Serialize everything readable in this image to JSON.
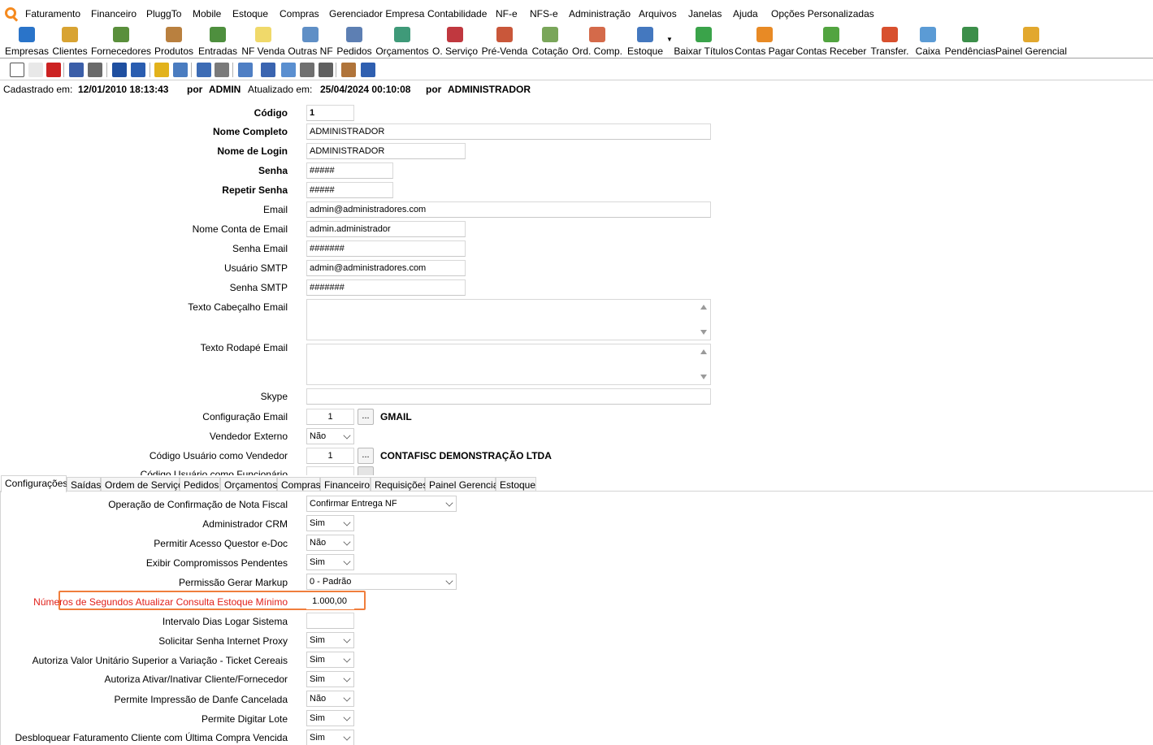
{
  "menu": {
    "logo_name": "app-logo-icon",
    "items": [
      "Faturamento",
      "Financeiro",
      "PluggTo",
      "Mobile",
      "Estoque",
      "Compras",
      "Gerenciador Empresa",
      "Contabilidade",
      "NF-e",
      "NFS-e",
      "Administração",
      "Arquivos",
      "Janelas",
      "Ajuda",
      "Opções Personalizadas"
    ]
  },
  "big_toolbar": [
    {
      "label": "Empresas",
      "icon": "empresas-icon",
      "color": "#2a74c9"
    },
    {
      "label": "Clientes",
      "icon": "clientes-icon",
      "color": "#d8a332"
    },
    {
      "label": "Fornecedores",
      "icon": "fornecedores-icon",
      "color": "#5a8f3c"
    },
    {
      "label": "Produtos",
      "icon": "produtos-icon",
      "color": "#b9803f"
    },
    {
      "label": "Entradas",
      "icon": "entradas-icon",
      "color": "#4e8f3e"
    },
    {
      "label": "NF Venda",
      "icon": "nf-venda-icon",
      "color": "#f0d96a"
    },
    {
      "label": "Outras NF",
      "icon": "outras-nf-icon",
      "color": "#5f8fc6"
    },
    {
      "label": "Pedidos",
      "icon": "pedidos-icon",
      "color": "#5d7fb3"
    },
    {
      "label": "Orçamentos",
      "icon": "orcamentos-icon",
      "color": "#3f9a79"
    },
    {
      "label": "O. Serviço",
      "icon": "ordem-servico-icon",
      "color": "#c0383f"
    },
    {
      "label": "Pré-Venda",
      "icon": "pre-venda-icon",
      "color": "#c9573a"
    },
    {
      "label": "Cotação",
      "icon": "cotacao-icon",
      "color": "#7aa65a"
    },
    {
      "label": "Ord. Comp.",
      "icon": "ordem-compra-icon",
      "color": "#d46a4a"
    },
    {
      "label": "Estoque",
      "icon": "estoque-icon",
      "color": "#4478bf"
    },
    {
      "label": "Baixar Títulos",
      "icon": "baixar-titulos-icon",
      "color": "#3aa34a"
    },
    {
      "label": "Contas Pagar",
      "icon": "contas-pagar-icon",
      "color": "#e88a25"
    },
    {
      "label": "Contas Receber",
      "icon": "contas-receber-icon",
      "color": "#52a440"
    },
    {
      "label": "Transfer.",
      "icon": "transferencia-icon",
      "color": "#d8502e"
    },
    {
      "label": "Caixa",
      "icon": "caixa-icon",
      "color": "#5b9bd5"
    },
    {
      "label": "Pendências",
      "icon": "pendencias-icon",
      "color": "#3c8f4a"
    },
    {
      "label": "Painel Gerencial",
      "icon": "painel-gerencial-icon",
      "color": "#e2a82e"
    }
  ],
  "small_toolbar": [
    "new-icon",
    "edit-icon",
    "delete-icon",
    "search-icon",
    "print-icon",
    "save-icon",
    "undo-icon",
    "help-icon",
    "calculator-icon",
    "report-icon",
    "tools-icon",
    "copy-window-icon",
    "find-icon",
    "duplicate-icon",
    "cut-icon",
    "keyboard-icon",
    "user-icon",
    "export-icon"
  ],
  "audit": {
    "cadastrado_label": "Cadastrado em:",
    "cadastrado_value": "12/01/2010 18:13:43",
    "por1_label": "por",
    "por1_value": "ADMIN",
    "atualizado_label": "Atualizado em:",
    "atualizado_value": "25/04/2024 00:10:08",
    "por2_label": "por",
    "por2_value": "ADMINISTRADOR"
  },
  "form": {
    "codigo": {
      "label": "Código",
      "value": "1"
    },
    "nome_completo": {
      "label": "Nome Completo",
      "value": "ADMINISTRADOR"
    },
    "nome_login": {
      "label": "Nome de Login",
      "value": "ADMINISTRADOR"
    },
    "senha": {
      "label": "Senha",
      "value": "#####"
    },
    "repetir_senha": {
      "label": "Repetir Senha",
      "value": "#####"
    },
    "email": {
      "label": "Email",
      "value": "admin@administradores.com"
    },
    "nome_conta_email": {
      "label": "Nome Conta de Email",
      "value": "admin.administrador"
    },
    "senha_email": {
      "label": "Senha Email",
      "value": "#######"
    },
    "usuario_smtp": {
      "label": "Usuário SMTP",
      "value": "admin@administradores.com"
    },
    "senha_smtp": {
      "label": "Senha SMTP",
      "value": "#######"
    },
    "texto_cabecalho": {
      "label": "Texto Cabeçalho Email",
      "value": ""
    },
    "texto_rodape": {
      "label": "Texto Rodapé Email",
      "value": ""
    },
    "skype": {
      "label": "Skype",
      "value": ""
    },
    "config_email": {
      "label": "Configuração Email",
      "value": "1",
      "button": "...",
      "desc": "GMAIL"
    },
    "vendedor_externo": {
      "label": "Vendedor Externo",
      "value": "Não"
    },
    "cod_usuario_vendedor": {
      "label": "Código Usuário como Vendedor",
      "value": "1",
      "button": "...",
      "desc": "CONTAFISC DEMONSTRAÇÃO LTDA"
    },
    "cod_usuario_funcionario": {
      "label": "Código Usuário como Funcionário"
    }
  },
  "tabs": [
    "Configurações",
    "Saídas",
    "Ordem de Serviço",
    "Pedidos",
    "Orçamentos",
    "Compras",
    "Financeiro",
    "Requisições",
    "Painel Gerencial",
    "Estoque"
  ],
  "config": {
    "op_confirmacao": {
      "label": "Operação de Confirmação de Nota Fiscal",
      "value": "Confirmar Entrega NF"
    },
    "admin_crm": {
      "label": "Administrador CRM",
      "value": "Sim"
    },
    "acesso_questor": {
      "label": "Permitir Acesso Questor e-Doc",
      "value": "Não"
    },
    "exibir_compromissos": {
      "label": "Exibir Compromissos Pendentes",
      "value": "Sim"
    },
    "permissao_markup": {
      "label": "Permissão Gerar Markup",
      "value": "0 - Padrão"
    },
    "segundos_estoque": {
      "label": "Números de Segundos Atualizar Consulta Estoque Mínimo",
      "value": "1.000,00"
    },
    "intervalo_dias": {
      "label": "Intervalo Dias Logar Sistema",
      "value": ""
    },
    "senha_proxy": {
      "label": "Solicitar Senha Internet Proxy",
      "value": "Sim"
    },
    "autoriza_valor": {
      "label": "Autoriza Valor Unitário Superior a Variação - Ticket Cereais",
      "value": "Sim"
    },
    "autoriza_ativar": {
      "label": "Autoriza Ativar/Inativar Cliente/Fornecedor",
      "value": "Sim"
    },
    "impressao_danfe": {
      "label": "Permite Impressão de Danfe Cancelada",
      "value": "Não"
    },
    "digitar_lote": {
      "label": "Permite Digitar Lote",
      "value": "Sim"
    },
    "desbloquear": {
      "label": "Desbloquear Faturamento Cliente com Última Compra Vencida",
      "value": "Sim"
    }
  },
  "colors": {
    "highlight": "#f07e3c",
    "highlight_text": "#e0201a",
    "logo": "#f58a1f"
  }
}
